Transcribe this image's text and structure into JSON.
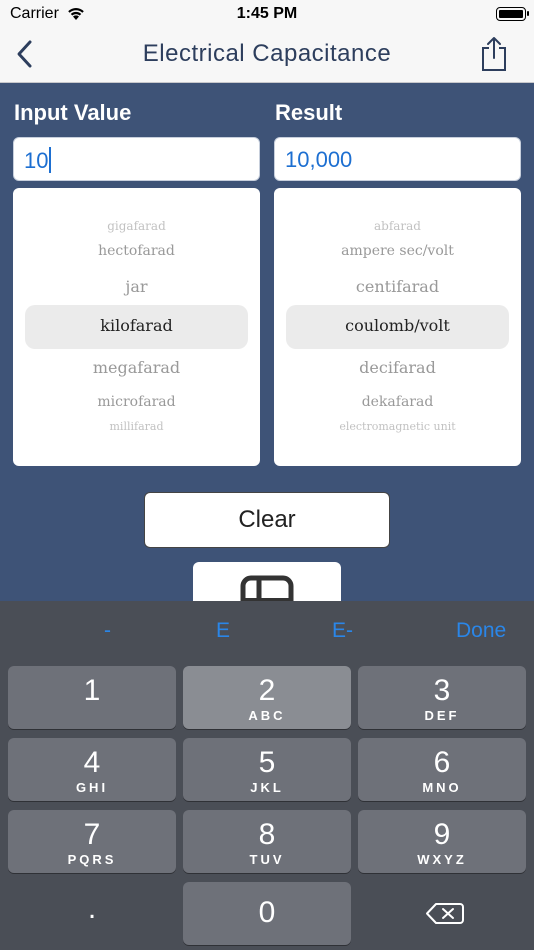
{
  "status": {
    "carrier": "Carrier",
    "time": "1:45 PM"
  },
  "nav": {
    "title": "Electrical Capacitance"
  },
  "input": {
    "label": "Input Value",
    "value": "10"
  },
  "result": {
    "label": "Result",
    "value": "10,000"
  },
  "input_units": {
    "items": [
      "gigafarad",
      "hectofarad",
      "jar",
      "kilofarad",
      "megafarad",
      "microfarad",
      "millifarad"
    ],
    "selected": "kilofarad"
  },
  "result_units": {
    "items": [
      "abfarad",
      "ampere sec/volt",
      "centifarad",
      "coulomb/volt",
      "decifarad",
      "dekafarad",
      "electromagnetic unit"
    ],
    "selected": "coulomb/volt"
  },
  "clear_label": "Clear",
  "keyboard": {
    "accessory": {
      "minus": "-",
      "e": "E",
      "e_minus": "E-",
      "done": "Done"
    },
    "keys": [
      {
        "digit": "1",
        "letters": ""
      },
      {
        "digit": "2",
        "letters": "ABC"
      },
      {
        "digit": "3",
        "letters": "DEF"
      },
      {
        "digit": "4",
        "letters": "GHI"
      },
      {
        "digit": "5",
        "letters": "JKL"
      },
      {
        "digit": "6",
        "letters": "MNO"
      },
      {
        "digit": "7",
        "letters": "PQRS"
      },
      {
        "digit": "8",
        "letters": "TUV"
      },
      {
        "digit": "9",
        "letters": "WXYZ"
      }
    ],
    "dot": ".",
    "zero": "0"
  },
  "colors": {
    "background": "#3e5377",
    "accent": "#1d6fd1",
    "title": "#2d3e5d"
  },
  "icons": {
    "back": "chevron-left-icon",
    "share": "share-icon",
    "backspace": "delete-left-icon"
  }
}
